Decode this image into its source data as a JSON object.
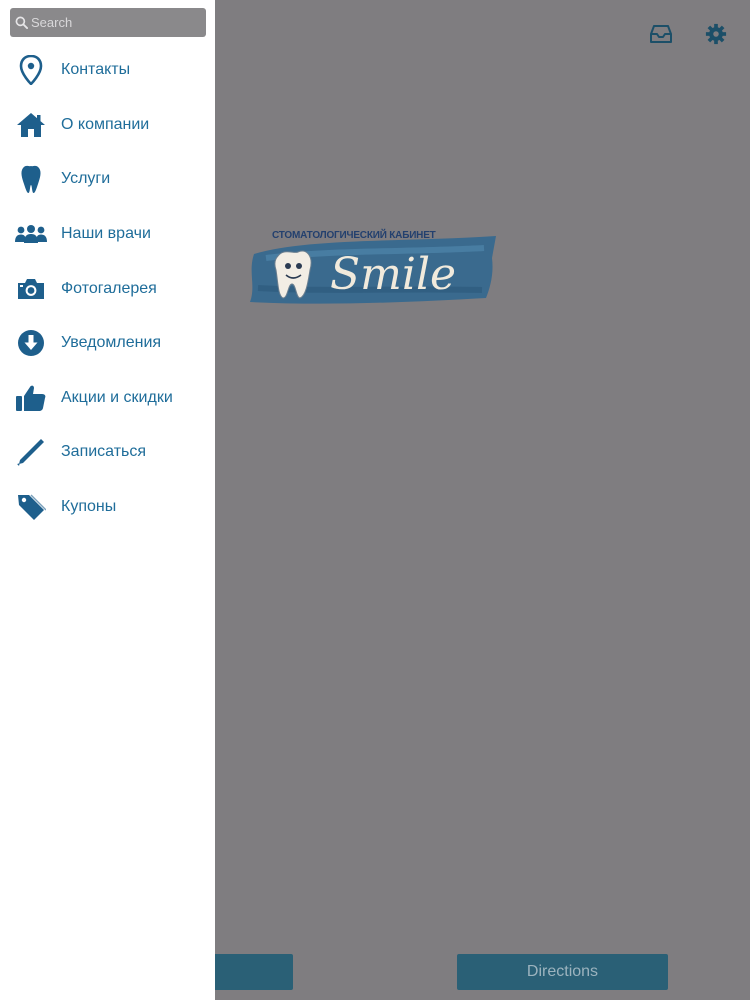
{
  "search": {
    "placeholder": "Search"
  },
  "menu": {
    "items": [
      {
        "label": "Контакты",
        "icon": "map-pin-icon"
      },
      {
        "label": "О компании",
        "icon": "home-icon"
      },
      {
        "label": "Услуги",
        "icon": "tooth-icon"
      },
      {
        "label": "Наши врачи",
        "icon": "people-icon"
      },
      {
        "label": "Фотогалерея",
        "icon": "camera-icon"
      },
      {
        "label": "Уведомления",
        "icon": "download-circle-icon"
      },
      {
        "label": "Акции и скидки",
        "icon": "thumbs-up-icon"
      },
      {
        "label": "Записаться",
        "icon": "pencil-icon"
      },
      {
        "label": "Купоны",
        "icon": "tag-icon"
      }
    ]
  },
  "header": {
    "icons": [
      "inbox-icon",
      "gear-icon"
    ]
  },
  "logo": {
    "caption": "СТОМАТОЛОГИЧЕСКИЙ КАБИНЕТ",
    "brand": "Smile"
  },
  "footer": {
    "directions_label": "Directions"
  },
  "colors": {
    "accent": "#1f6d9a",
    "icon": "#1e5f8c",
    "overlay": "#7f7d80",
    "drawer_bg": "#ffffff",
    "button": "#2a6076"
  }
}
